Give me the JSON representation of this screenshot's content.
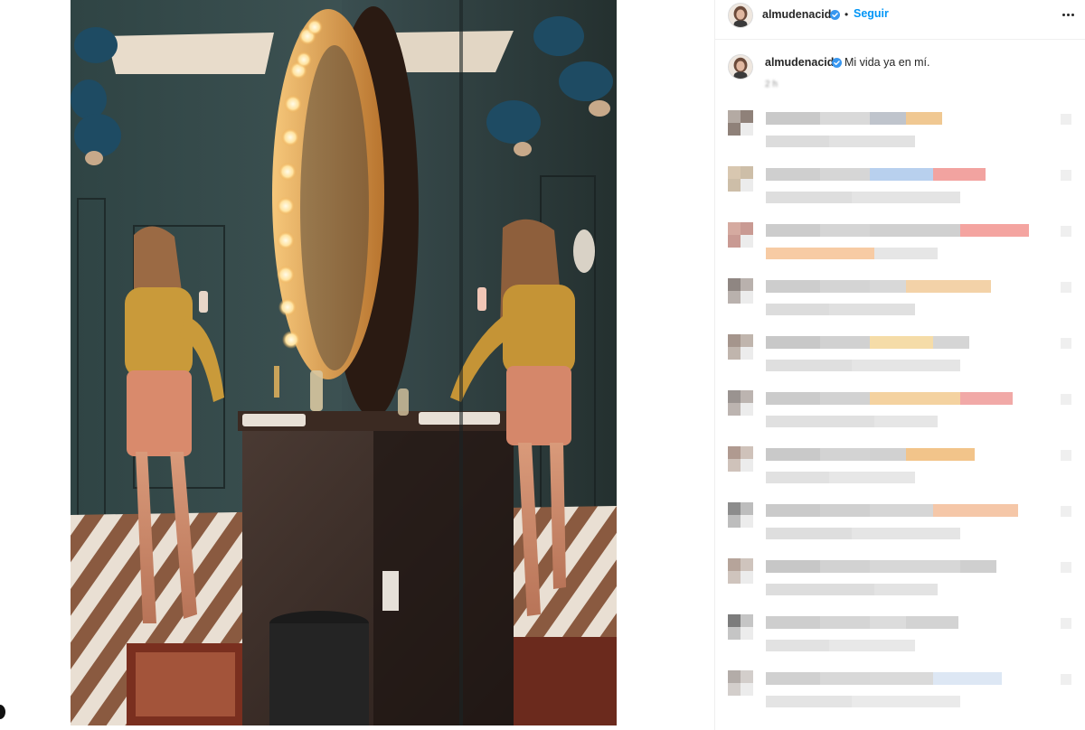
{
  "post": {
    "image_alt": "Mujer haciéndose un selfie frente a un espejo ovalado con luces en un baño",
    "header": {
      "username": "almudenacid",
      "separator": "•",
      "follow_label": "Seguir"
    },
    "caption": {
      "username": "almudenacid",
      "text": "Mi vida ya en mí.",
      "time": "2 h"
    }
  },
  "icons": {
    "verified": "verified-badge-icon",
    "more": "more-options-icon"
  },
  "colors": {
    "accent": "#0095f6",
    "verified": "#3897f0",
    "text": "#262626",
    "muted": "#8e8e8e",
    "divider": "#efefef"
  },
  "comments": {
    "pixelated": true,
    "rows": [
      {
        "avatar": [
          "#b4aaa3",
          "#8f8179"
        ],
        "line1": [
          "#c9c9c9",
          "#d9d9d9",
          "#bfc4cc",
          "#f0c892"
        ],
        "line2": [
          "#dcdcdc",
          "#e2e2e2"
        ]
      },
      {
        "avatar": [
          "#d8c7b0",
          "#cdbea8"
        ],
        "line1": [
          "#cfcfcf",
          "#d6d6d6",
          "#b8d0ee",
          "#f2a3a0"
        ],
        "line2": [
          "#dedede",
          "#e4e4e4"
        ]
      },
      {
        "avatar": [
          "#d5aaa0",
          "#c99a93"
        ],
        "line1": [
          "#cccccc",
          "#d5d5d5",
          "#d0d0d0",
          "#f4a4a0"
        ],
        "line2": [
          "#f7cba4",
          "#e6e6e6"
        ]
      },
      {
        "avatar": [
          "#8f8682",
          "#b9b1ad"
        ],
        "line1": [
          "#cdcdcd",
          "#d4d4d4",
          "#d8d8d8",
          "#f3d2a8"
        ],
        "line2": [
          "#dcdcdc",
          "#e0e0e0"
        ]
      },
      {
        "avatar": [
          "#a5958c",
          "#c0b5ad"
        ],
        "line1": [
          "#c8c8c8",
          "#d1d1d1",
          "#f5dca8",
          "#d5d5d5"
        ],
        "line2": [
          "#dfdfdf",
          "#e5e5e5"
        ]
      },
      {
        "avatar": [
          "#9a9390",
          "#bcb4b0"
        ],
        "line1": [
          "#cbcbcb",
          "#d2d2d2",
          "#f4d2a0",
          "#f1a9a7"
        ],
        "line2": [
          "#e0e0e0",
          "#e6e6e6"
        ]
      },
      {
        "avatar": [
          "#b09a90",
          "#cfc2ba"
        ],
        "line1": [
          "#c9c9c9",
          "#d3d3d3",
          "#d1d1d1",
          "#f2c48a"
        ],
        "line2": [
          "#e1e1e1",
          "#e7e7e7"
        ]
      },
      {
        "avatar": [
          "#8c8c8c",
          "#bdbdbd"
        ],
        "line1": [
          "#cacaca",
          "#d0d0d0",
          "#d6d6d6",
          "#f5c7a8"
        ],
        "line2": [
          "#dedede",
          "#e5e5e5"
        ]
      },
      {
        "avatar": [
          "#b6a49a",
          "#cfc4bd"
        ],
        "line1": [
          "#c7c7c7",
          "#d2d2d2",
          "#d7d7d7",
          "#cfcfcf"
        ],
        "line2": [
          "#dddddd",
          "#e3e3e3"
        ]
      },
      {
        "avatar": [
          "#7c7c7c",
          "#c5c5c5"
        ],
        "line1": [
          "#cecece",
          "#d5d5d5",
          "#dcdcdc",
          "#d3d3d3"
        ],
        "line2": [
          "#e2e2e2",
          "#e8e8e8"
        ]
      },
      {
        "avatar": [
          "#b3aca8",
          "#d3cecb"
        ],
        "line1": [
          "#d0d0d0",
          "#d8d8d8",
          "#dadada",
          "#dde7f4"
        ],
        "line2": [
          "#e4e4e4",
          "#eaeaea"
        ]
      }
    ]
  }
}
